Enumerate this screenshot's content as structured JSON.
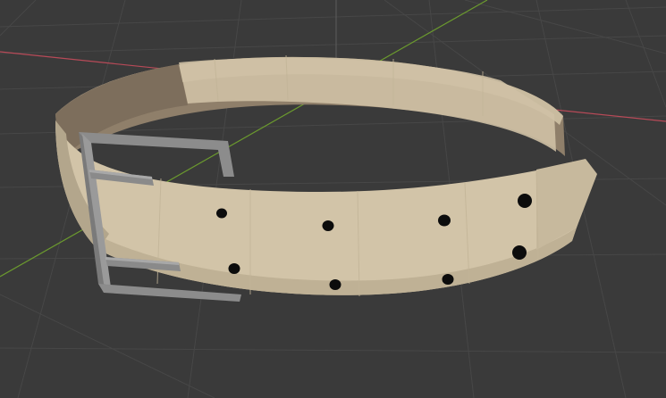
{
  "viewport": {
    "background": "#3a3a3a",
    "grid_color": "#4a4a4a",
    "x_axis_color": "#b84a58",
    "y_axis_color": "#6b9a2e",
    "z_axis_color": "#5a5a5a"
  },
  "model": {
    "object": "belt",
    "belt_color": "#d2c4a8",
    "belt_shade_color": "#b3a68c",
    "belt_inner_color": "#8f7f6a",
    "buckle_color": "#8c8c8c",
    "buckle_highlight": "#a8a8a8",
    "hole_color": "#0c0c0c",
    "hole_count": 8
  }
}
